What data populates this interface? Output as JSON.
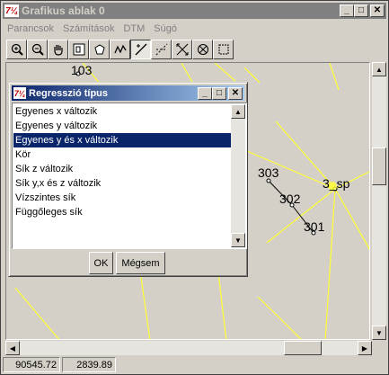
{
  "window": {
    "title": "Grafikus ablak 0",
    "app_icon_text": "7¼",
    "controls": {
      "minimize": "_",
      "maximize": "□",
      "close": "✕"
    }
  },
  "menu": [
    "Parancsok",
    "Számítások",
    "DTM",
    "Súgó"
  ],
  "toolbar": [
    {
      "icon": "zoom-in-icon",
      "pressed": false
    },
    {
      "icon": "zoom-out-icon",
      "pressed": false
    },
    {
      "icon": "pan-hand-icon",
      "pressed": false
    },
    {
      "icon": "zoom-window-icon",
      "pressed": false
    },
    {
      "icon": "zoom-extents-icon",
      "pressed": false
    },
    {
      "icon": "route-icon",
      "pressed": false
    },
    {
      "icon": "line-select-icon",
      "pressed": true
    },
    {
      "icon": "dashed-line-icon",
      "pressed": false
    },
    {
      "icon": "cross-arrows-icon",
      "pressed": false
    },
    {
      "icon": "polygon-icon",
      "pressed": false
    },
    {
      "icon": "rectangle-select-icon",
      "pressed": false
    }
  ],
  "canvas": {
    "point_labels": [
      "103",
      "303",
      "302",
      "301",
      "3_sp"
    ],
    "line_color": "#ffff33",
    "point_color": "#000000"
  },
  "status": {
    "x": "90545.72",
    "y": "2839.89"
  },
  "dialog": {
    "title": "Regresszió típus",
    "items": [
      "Egyenes x változik",
      "Egyenes y változik",
      "Egyenes y és x változik",
      "Kör",
      "Sík z változik",
      "Sík y,x és z változik",
      "Vízszintes sík",
      "Függőleges sík"
    ],
    "selected_index": 2,
    "ok_label": "OK",
    "cancel_label": "Mégsem"
  }
}
